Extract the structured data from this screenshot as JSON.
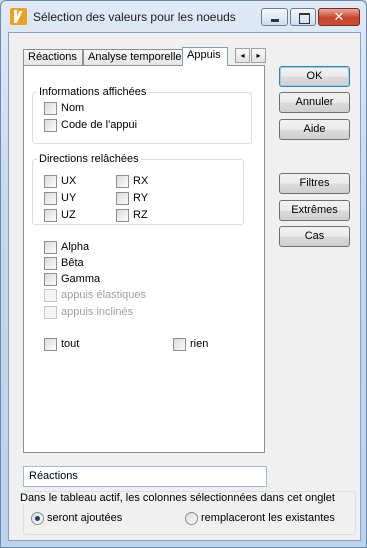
{
  "window": {
    "title": "Sélection des valeurs pour les noeuds",
    "close_glyph": "✕"
  },
  "tabs": [
    {
      "label": "Réactions",
      "selected": false
    },
    {
      "label": "Analyse temporelle",
      "selected": false
    },
    {
      "label": "Appuis",
      "selected": true
    }
  ],
  "tab_scroll": {
    "left_glyph": "◂",
    "right_glyph": "▸"
  },
  "informations": {
    "legend": "Informations affichées",
    "items": [
      {
        "label": "Nom",
        "checked": false
      },
      {
        "label": "Code de l'appui",
        "checked": false
      }
    ]
  },
  "directions": {
    "legend": "Directions relâchées",
    "items": [
      {
        "label": "UX",
        "checked": false
      },
      {
        "label": "UY",
        "checked": false
      },
      {
        "label": "UZ",
        "checked": false
      },
      {
        "label": "RX",
        "checked": false
      },
      {
        "label": "RY",
        "checked": false
      },
      {
        "label": "RZ",
        "checked": false
      }
    ]
  },
  "angles": [
    {
      "label": "Alpha",
      "checked": false,
      "enabled": true
    },
    {
      "label": "Bêta",
      "checked": false,
      "enabled": true
    },
    {
      "label": "Gamma",
      "checked": false,
      "enabled": true
    },
    {
      "label": "appuis élastiques",
      "checked": false,
      "enabled": false
    },
    {
      "label": "appuis inclinés",
      "checked": false,
      "enabled": false
    }
  ],
  "select_all": {
    "tout": "tout",
    "rien": "rien"
  },
  "buttons": {
    "ok": "OK",
    "annuler": "Annuler",
    "aide": "Aide",
    "filtres": "Filtres",
    "extremes": "Extrêmes",
    "cas": "Cas"
  },
  "active_tab_field": {
    "value": "Réactions"
  },
  "columns_option": {
    "caption": "Dans le tableau actif, les colonnes sélectionnées dans cet onglet",
    "options": [
      {
        "label": "seront ajoutées",
        "selected": true
      },
      {
        "label": "remplaceront les existantes",
        "selected": false
      }
    ]
  }
}
